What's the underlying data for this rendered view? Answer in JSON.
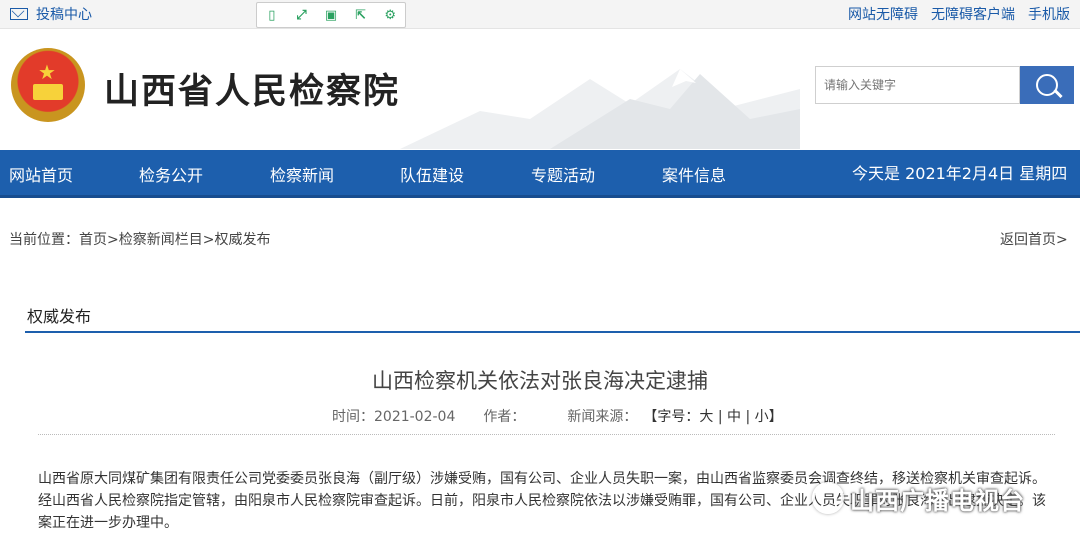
{
  "topbar": {
    "contribute": "投稿中心",
    "links": [
      "网站无障碍",
      "无障碍客户端",
      "手机版"
    ],
    "tools": [
      "mobile-icon",
      "expand-icon",
      "save-icon",
      "share-icon",
      "settings-icon"
    ]
  },
  "header": {
    "site_title": "山西省人民检察院",
    "search_placeholder": "请输入关键字"
  },
  "nav": {
    "items": [
      "网站首页",
      "检务公开",
      "检察新闻",
      "队伍建设",
      "专题活动",
      "案件信息"
    ],
    "date": "今天是 2021年2月4日 星期四"
  },
  "breadcrumb": "当前位置：首页>检察新闻栏目>权威发布",
  "back_link": "返回首页>",
  "section_title": "权威发布",
  "article": {
    "title": "山西检察机关依法对张良海决定逮捕",
    "time_label": "时间：2021-02-04",
    "author_label": "作者：",
    "source_label": "新闻来源：",
    "font_size_label": "【字号：大 | 中 | 小】",
    "body": "山西省原大同煤矿集团有限责任公司党委委员张良海（副厅级）涉嫌受贿，国有公司、企业人员失职一案，由山西省监察委员会调查终结，移送检察机关审查起诉。经山西省人民检察院指定管辖，由阳泉市人民检察院审查起诉。日前，阳泉市人民检察院依法以涉嫌受贿罪，国有公司、企业人员失职罪对张良海作出逮捕决定。该案正在进一步办理中。"
  },
  "watermark": "山西广播电视台",
  "colors": {
    "nav_blue": "#1d5fad",
    "link_blue": "#1a5aa8",
    "tool_green": "#2aa160"
  }
}
